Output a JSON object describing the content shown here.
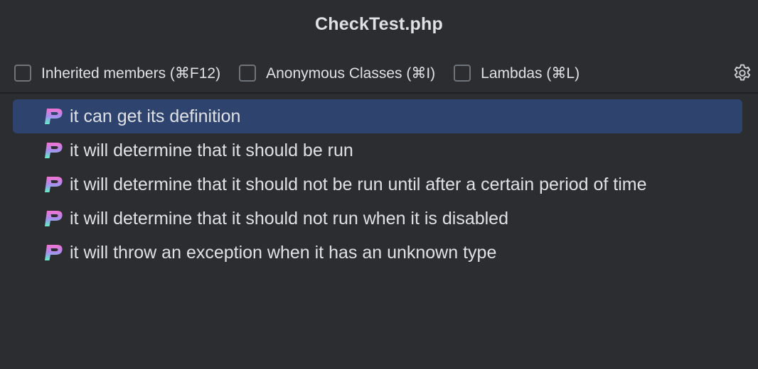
{
  "window": {
    "title": "CheckTest.php"
  },
  "filters": [
    {
      "label": "Inherited members (⌘F12)",
      "checked": false
    },
    {
      "label": "Anonymous Classes (⌘I)",
      "checked": false
    },
    {
      "label": "Lambdas (⌘L)",
      "checked": false
    }
  ],
  "settings": {
    "icon": "gear-icon"
  },
  "tests": {
    "icon": "pest-icon",
    "selected_index": 0,
    "items": [
      {
        "label": "it can get its definition"
      },
      {
        "label": "it will determine that it should be run"
      },
      {
        "label": "it will determine that it should not be run until after a certain period of time"
      },
      {
        "label": "it will determine that it should not run when it is disabled"
      },
      {
        "label": "it will throw an exception when it has an unknown type"
      }
    ]
  },
  "colors": {
    "background": "#2b2d30",
    "selection": "#2e436e",
    "text": "#dfe1e5",
    "icon_gradient_start": "#f472d0",
    "icon_gradient_end": "#5ef2c4"
  }
}
